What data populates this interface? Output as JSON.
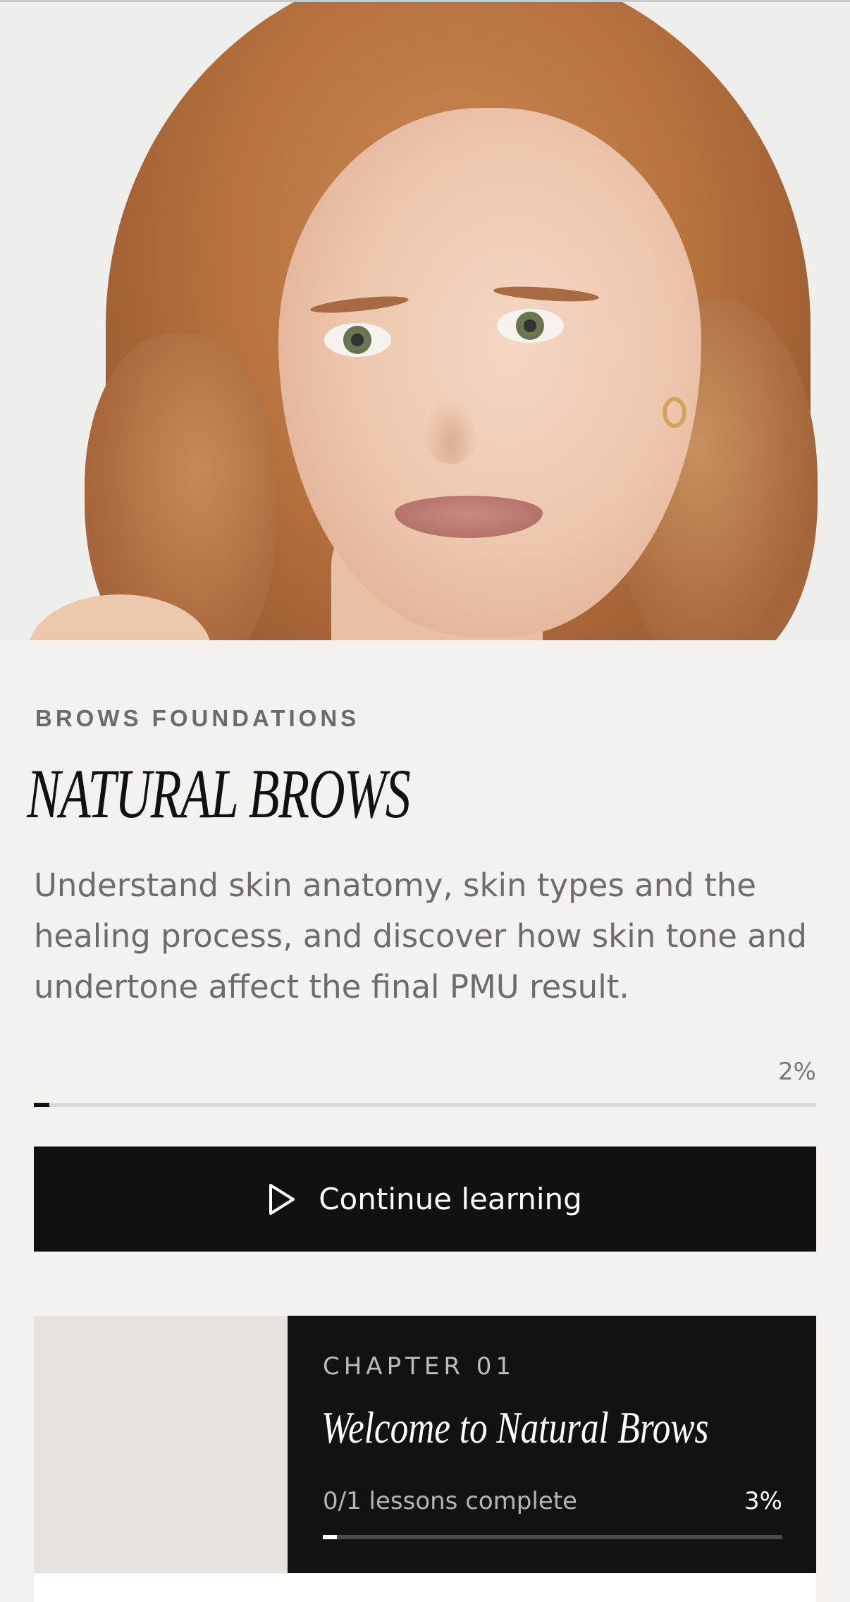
{
  "course": {
    "subtitle": "BROWS FOUNDATIONS",
    "title": "NATURAL BROWS",
    "description": "Understand skin anatomy, skin types and the healing process, and discover how skin tone and undertone affect the final PMU result.",
    "progress_label": "2%",
    "progress_value": 0.02
  },
  "cta": {
    "label": "Continue learning",
    "icon": "play-icon"
  },
  "chapters": [
    {
      "label": "CHAPTER 01",
      "title": "Welcome to Natural Brows",
      "lessons_text": "0/1 lessons complete",
      "progress_label": "3%",
      "progress_value": 0.03
    }
  ],
  "colors": {
    "background": "#f4f2f0",
    "primary": "#111111",
    "muted_text": "#6e6c6a",
    "track": "#dcdad8",
    "thumbnail": "#e6e3df"
  }
}
